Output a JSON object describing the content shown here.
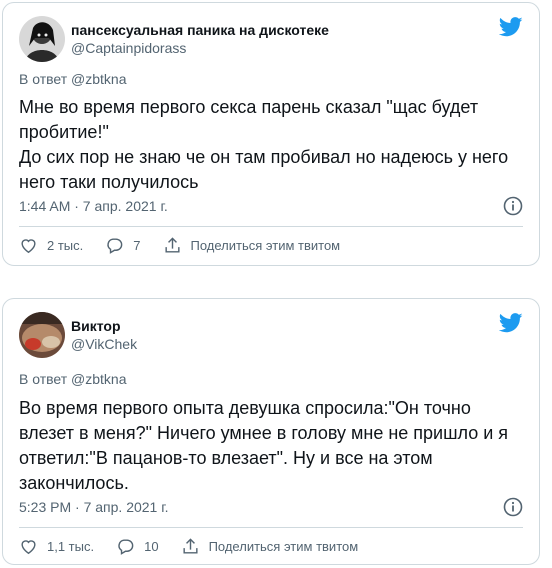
{
  "tweets": [
    {
      "display_name": "пансексуальная паника на дискотеке",
      "handle": "@Captainpidorass",
      "reply_to": "В ответ @zbtkna",
      "text": "Мне во время первого секса парень сказал \"щас будет пробитие!\"\nДо сих пор не знаю че он там пробивал но надеюсь у него него таки получилось",
      "timestamp": "1:44 AM · 7 апр. 2021 г.",
      "likes": "2 тыс.",
      "replies": "7",
      "share_label": "Поделиться этим твитом",
      "avatar_icon": "user-avatar-photo"
    },
    {
      "display_name": "Виктор",
      "handle": "@VikChek",
      "reply_to": "В ответ @zbtkna",
      "text": "Во время первого опыта девушка спросила:\"Он точно влезет в меня?\" Ничего умнее в голову мне не пришло и я ответил:\"В пацанов-то влезает\". Ну и все на этом закончилось.",
      "timestamp": "5:23 PM · 7 апр. 2021 г.",
      "likes": "1,1 тыс.",
      "replies": "10",
      "share_label": "Поделиться этим твитом",
      "avatar_icon": "user-avatar-photo"
    }
  ],
  "colors": {
    "twitter_blue": "#1d9bf0",
    "text_primary": "#0f1419",
    "text_secondary": "#536471",
    "border": "#cfd9de"
  },
  "icons": [
    "twitter-bird-icon",
    "info-icon",
    "heart-icon",
    "reply-icon",
    "share-icon"
  ]
}
